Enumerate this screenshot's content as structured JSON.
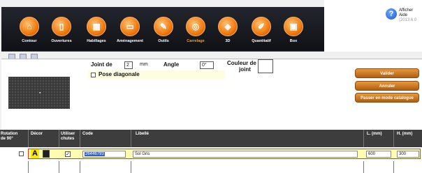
{
  "toolbar": {
    "items": [
      {
        "label": "Contour",
        "glyph": "⌂",
        "icon": "contour-icon"
      },
      {
        "label": "Ouvertures",
        "glyph": "▯",
        "icon": "door-icon"
      },
      {
        "label": "Habillages",
        "glyph": "▦",
        "icon": "wall-covering-icon"
      },
      {
        "label": "Aménagement",
        "glyph": "▭",
        "icon": "furniture-icon"
      },
      {
        "label": "Outils",
        "glyph": "✎",
        "icon": "tools-icon"
      },
      {
        "label": "Carrelage",
        "glyph": "◎",
        "icon": "tiling-icon"
      },
      {
        "label": "3D",
        "glyph": "◈",
        "icon": "3d-icon"
      },
      {
        "label": "Quantitatif",
        "glyph": "✐",
        "icon": "quantity-icon"
      },
      {
        "label": "Box",
        "glyph": "▣",
        "icon": "box-icon"
      }
    ],
    "active": "Carrelage"
  },
  "help": {
    "line1": "Afficher",
    "line2": "Aide",
    "glyph": "?",
    "version": "(2013.6.0"
  },
  "form": {
    "joint_label": "Joint de",
    "joint_value": "2",
    "joint_unit": "mm",
    "angle_label": "Angle",
    "angle_value": "0°",
    "couleur_label_1": "Couleur de",
    "couleur_label_2": "joint",
    "pose_label": "Pose diagonale"
  },
  "buttons": {
    "valider": "Valider",
    "annuler": "Annuler",
    "catalogue": "Passer en mode catalogue"
  },
  "table": {
    "headers": {
      "rotation_1": "Rotation",
      "rotation_2": "de 90°",
      "decor": "Décor",
      "utiliser_1": "Utiliser",
      "utiliser_2": "chutes",
      "code": "Code",
      "libelle": "Libellé",
      "l": "L. (mm)",
      "h": "H. (mm)"
    },
    "row": {
      "decor_letter": "A",
      "use_check": "✓",
      "code": "26446793",
      "libelle": "Sol Gris",
      "l": "600",
      "h": "300"
    }
  },
  "colors": {
    "accent": "#f07a10",
    "highlight": "#fffbb0",
    "selection_border": "#e03020"
  }
}
